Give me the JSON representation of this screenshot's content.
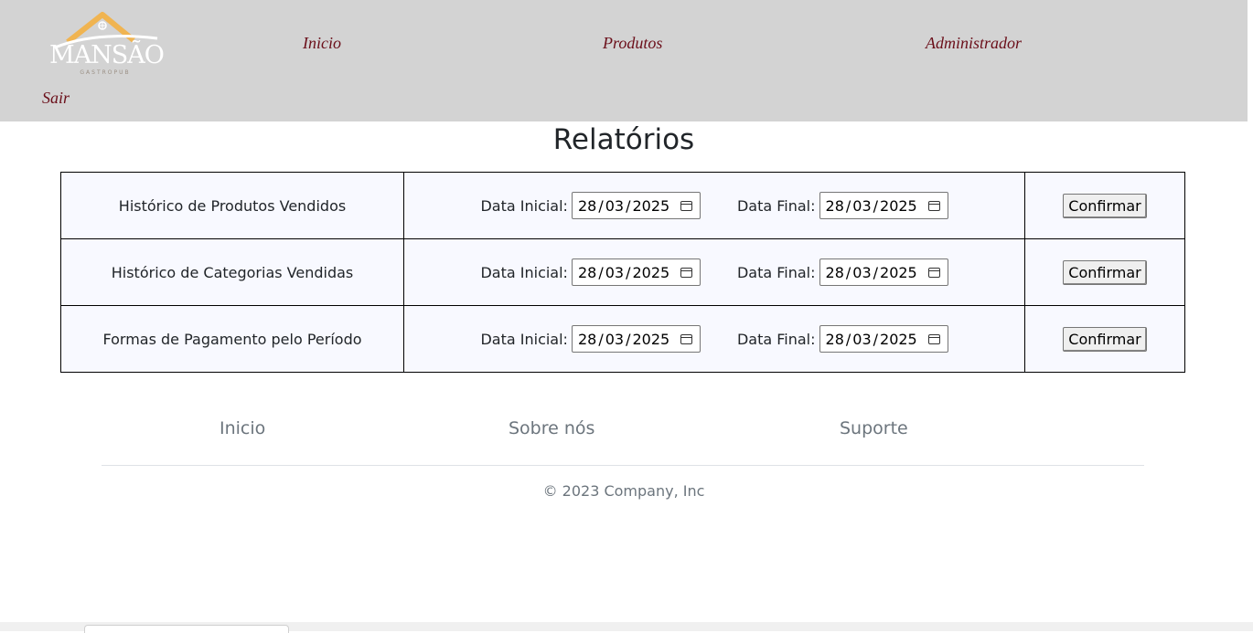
{
  "header": {
    "logo": {
      "name": "MANSÃO",
      "sub": "GASTROPUB"
    },
    "nav": [
      "Inicio",
      "Produtos",
      "Administrador"
    ],
    "logout": "Sair"
  },
  "page_title": "Relatórios",
  "reports": [
    {
      "name": "Histórico de Produtos Vendidos",
      "start_label": "Data Inicial:",
      "start": {
        "d": "28",
        "m": "03",
        "y": "2025"
      },
      "end_label": "Data Final:",
      "end": {
        "d": "28",
        "m": "03",
        "y": "2025"
      },
      "button": "Confirmar"
    },
    {
      "name": "Histórico de Categorias Vendidas",
      "start_label": "Data Inicial:",
      "start": {
        "d": "28",
        "m": "03",
        "y": "2025"
      },
      "end_label": "Data Final:",
      "end": {
        "d": "28",
        "m": "03",
        "y": "2025"
      },
      "button": "Confirmar"
    },
    {
      "name": "Formas de Pagamento pelo Período",
      "start_label": "Data Inicial:",
      "start": {
        "d": "28",
        "m": "03",
        "y": "2025"
      },
      "end_label": "Data Final:",
      "end": {
        "d": "28",
        "m": "03",
        "y": "2025"
      },
      "button": "Confirmar"
    }
  ],
  "footer": {
    "links": [
      "Inicio",
      "Sobre nós",
      "Suporte"
    ],
    "copyright": "© 2023 Company, Inc"
  },
  "colors": {
    "header_bg": "#d3d3d3",
    "nav_text": "#6b0f1a",
    "table_bg": "#f8f9ff",
    "logo_roof": "#f0b451"
  }
}
